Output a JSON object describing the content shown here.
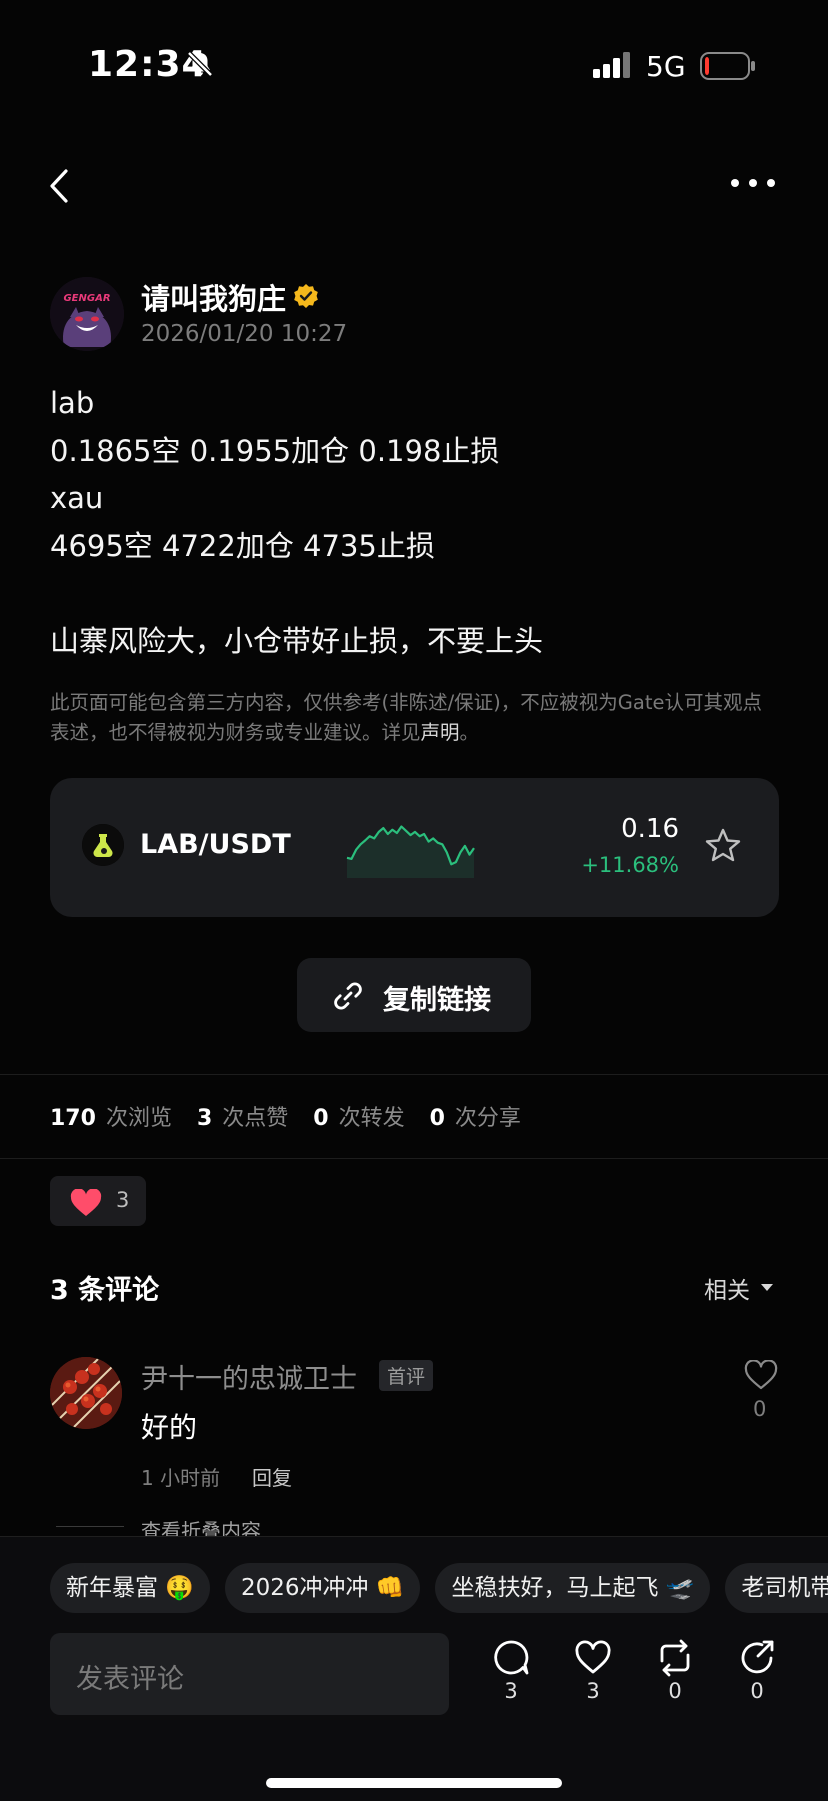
{
  "status_bar": {
    "time": "12:34",
    "network": "5G",
    "battery_level": 0.1
  },
  "header": {
    "back_icon": "chevron-left-icon",
    "more_icon": "ellipsis-icon"
  },
  "post": {
    "author": "请叫我狗庄",
    "avatar_text": "GENGAR",
    "timestamp": "2026/01/20 10:27",
    "lines": [
      "lab",
      "0.1865空 0.1955加仓  0.198止损",
      "xau",
      "4695空 4722加仓 4735止损",
      "",
      "山寨风险大，小仓带好止损，不要上头"
    ],
    "disclaimer_text": "此页面可能包含第三方内容，仅供参考(非陈述/保证)，不应被视为Gate认可其观点表述，也不得被视为财务或专业建议。详见",
    "disclaimer_link": "声明",
    "disclaimer_end": "。"
  },
  "ticker": {
    "pair": "LAB/USDT",
    "price": "0.16",
    "change": "+11.68%",
    "change_color": "#2bbf7d",
    "sparkline": [
      0.3,
      0.28,
      0.45,
      0.55,
      0.62,
      0.7,
      0.66,
      0.78,
      0.85,
      0.74,
      0.82,
      0.76,
      0.88,
      0.8,
      0.72,
      0.78,
      0.7,
      0.74,
      0.6,
      0.66,
      0.58,
      0.55,
      0.4,
      0.18,
      0.22,
      0.4,
      0.52,
      0.36,
      0.48
    ]
  },
  "copy_link": {
    "label": "复制链接"
  },
  "stats": [
    {
      "value": "170",
      "label": "次浏览"
    },
    {
      "value": "3",
      "label": "次点赞"
    },
    {
      "value": "0",
      "label": "次转发"
    },
    {
      "value": "0",
      "label": "次分享"
    }
  ],
  "reactions": {
    "count": "3"
  },
  "comments": {
    "title": "3 条评论",
    "sort": "相关",
    "items": [
      {
        "name": "尹十一的忠诚卫士",
        "tag": "首评",
        "text": "好的",
        "time": "1 小时前",
        "reply": "回复",
        "likes": "0"
      }
    ],
    "folded": "查看折叠内容"
  },
  "bottom_bar": {
    "chips": [
      "新年暴富 🤑",
      "2026冲冲冲 👊",
      "坐稳扶好，马上起飞 🛫",
      "老司机带带我"
    ],
    "input_placeholder": "发表评论",
    "actions": [
      {
        "icon": "comment-icon",
        "count": "3"
      },
      {
        "icon": "heart-icon",
        "count": "3"
      },
      {
        "icon": "repost-icon",
        "count": "0"
      },
      {
        "icon": "share-icon",
        "count": "0"
      }
    ]
  }
}
